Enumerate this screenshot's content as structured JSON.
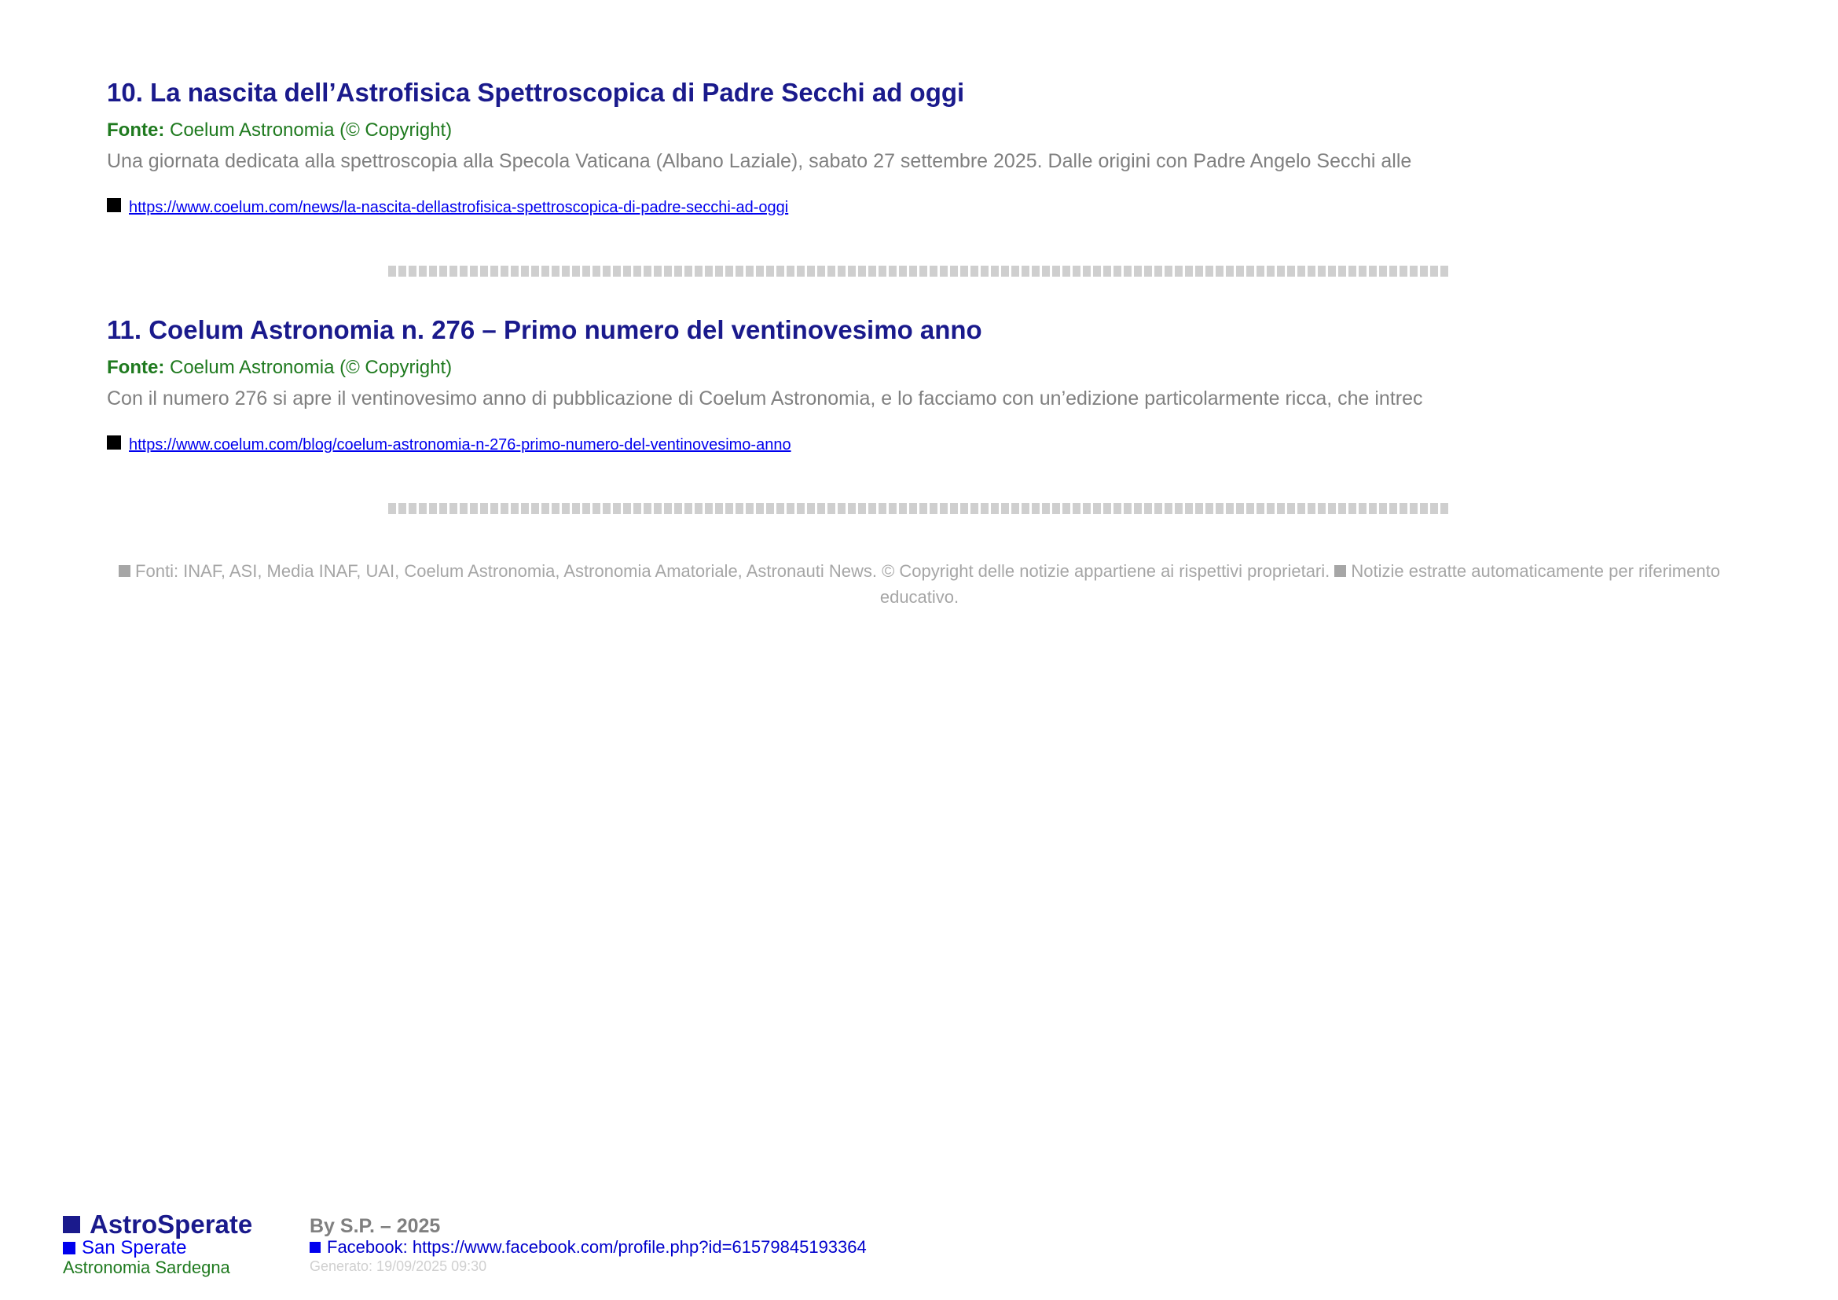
{
  "articles": [
    {
      "title": "10. La nascita dell’Astrofisica Spettroscopica di Padre Secchi ad oggi",
      "source_label": "Fonte:",
      "source_value": "Coelum Astronomia (© Copyright)",
      "summary": "Una giornata dedicata alla spettroscopia alla Specola Vaticana (Albano Laziale), sabato 27 settembre 2025. Dalle origini con Padre Angelo Secchi alle",
      "link": "https://www.coelum.com/news/la-nascita-dellastrofisica-spettroscopica-di-padre-secchi-ad-oggi"
    },
    {
      "title": "11. Coelum Astronomia n. 276 – Primo numero del ventinovesimo anno",
      "source_label": "Fonte:",
      "source_value": "Coelum Astronomia (© Copyright)",
      "summary": "Con il numero 276 si apre il ventinovesimo anno di pubblicazione di Coelum Astronomia, e lo facciamo con un’edizione particolarmente ricca, che intrec",
      "link": "https://www.coelum.com/blog/coelum-astronomia-n-276-primo-numero-del-ventinovesimo-anno"
    }
  ],
  "footer_notes": {
    "sources": "Fonti: INAF, ASI, Media INAF, UAI, Coelum Astronomia, Astronomia Amatoriale, Astronauti News. © Copyright delle notizie appartiene ai rispettivi proprietari.",
    "disclaimer": "Notizie estratte automaticamente per riferimento educativo."
  },
  "brand": {
    "title": "AstroSperate",
    "subtitle": "San Sperate",
    "tagline": "Astronomia Sardegna"
  },
  "credits": {
    "author": "By S.P. – 2025",
    "facebook": "Facebook: https://www.facebook.com/profile.php?id=61579845193364",
    "generated": "Generato: 19/09/2025 09:30"
  },
  "colors": {
    "title": "#1a1a8c",
    "source": "#1f7a1f",
    "summary": "#808080",
    "link": "#0000ee",
    "separator": "#cfcfcf"
  }
}
